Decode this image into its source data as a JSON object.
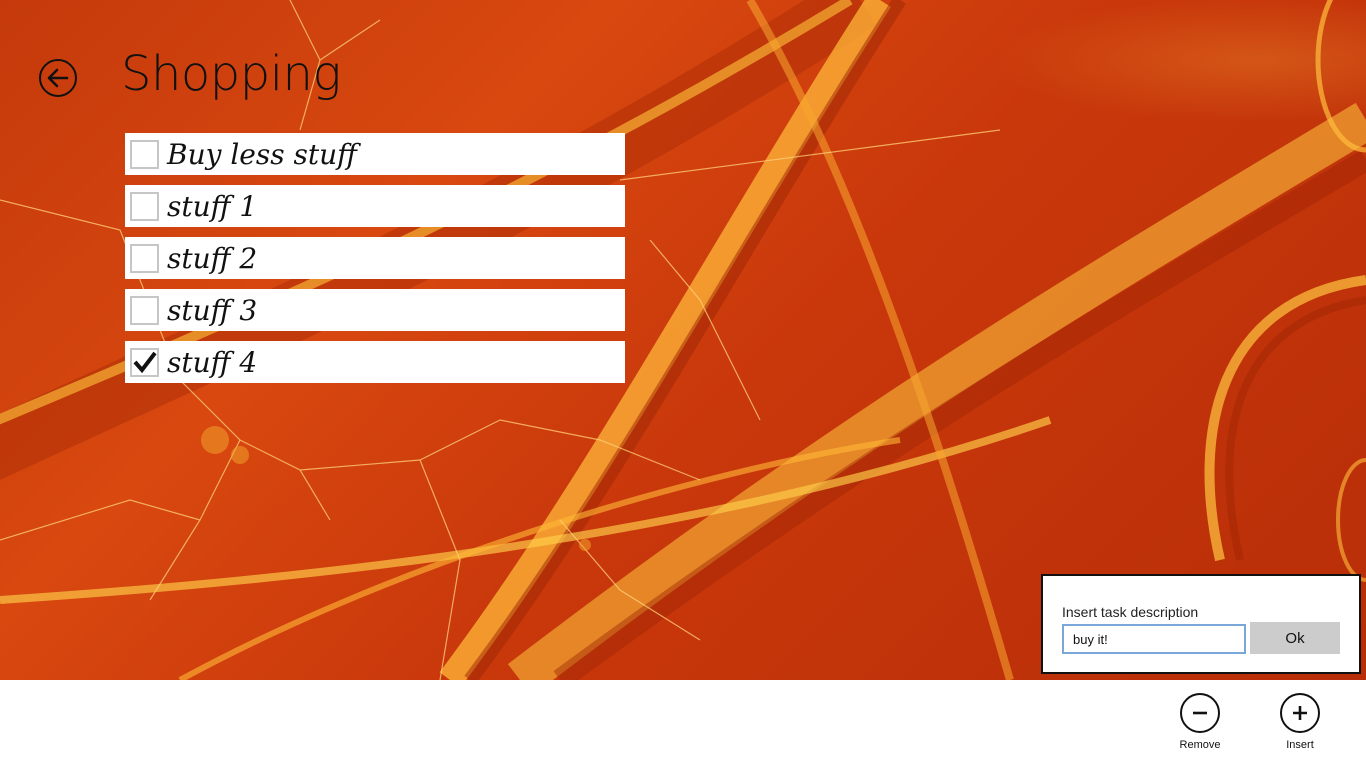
{
  "header": {
    "title": "Shopping",
    "back_icon": "back-arrow-icon"
  },
  "tasks": [
    {
      "label": "Buy less stuff",
      "checked": false
    },
    {
      "label": "stuff 1",
      "checked": false
    },
    {
      "label": "stuff 2",
      "checked": false
    },
    {
      "label": "stuff 3",
      "checked": false
    },
    {
      "label": "stuff 4",
      "checked": true
    }
  ],
  "flyout": {
    "label": "Insert task description",
    "input_value": "buy it!",
    "clear_icon": "close-icon",
    "ok_label": "Ok"
  },
  "app_bar": {
    "remove_label": "Remove",
    "remove_icon": "minus-icon",
    "insert_label": "Insert",
    "insert_icon": "plus-icon"
  },
  "colors": {
    "background_primary": "#c53a0c",
    "background_highlight": "#f5b63a",
    "input_border": "#7aa6d8",
    "ok_button": "#cccccc"
  }
}
